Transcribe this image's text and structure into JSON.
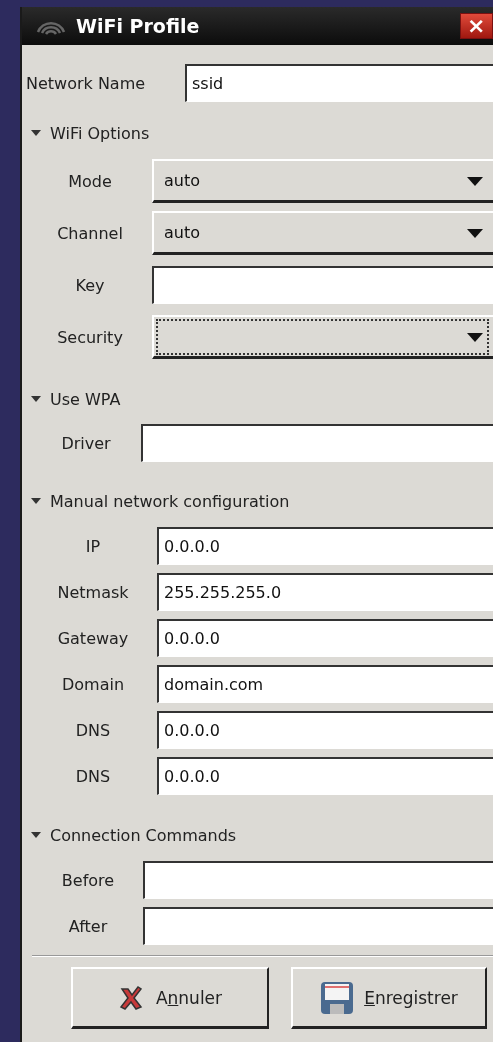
{
  "window": {
    "title": "WiFi Profile",
    "close": "×"
  },
  "network_name": {
    "label": "Network Name",
    "value": "ssid"
  },
  "sections": [
    {
      "title": "WiFi Options",
      "expanded": true,
      "fields": [
        {
          "kind": "combo",
          "label": "Mode",
          "value": "auto",
          "focused": false
        },
        {
          "kind": "combo",
          "label": "Channel",
          "value": "auto",
          "focused": false
        },
        {
          "kind": "entry",
          "label": "Key"
        },
        {
          "kind": "combo",
          "label": "Security",
          "focused": true
        }
      ]
    },
    {
      "title": "Use WPA",
      "expanded": true,
      "fields": [
        {
          "kind": "entry",
          "label": "Driver"
        }
      ]
    },
    {
      "title": "Manual network configuration",
      "expanded": true,
      "fields": [
        {
          "kind": "entry",
          "label": "IP",
          "value": "0.0.0.0"
        },
        {
          "kind": "entry",
          "label": "Netmask",
          "value": "255.255.255.0"
        },
        {
          "kind": "entry",
          "label": "Gateway",
          "value": "0.0.0.0"
        },
        {
          "kind": "entry",
          "label": "Domain",
          "value": "domain.com"
        },
        {
          "kind": "entry",
          "label": "DNS",
          "value": "0.0.0.0"
        },
        {
          "kind": "entry",
          "label": "DNS",
          "value": "0.0.0.0"
        }
      ]
    },
    {
      "title": "Connection Commands",
      "expanded": true,
      "fields": [
        {
          "kind": "entry",
          "label": "Before"
        },
        {
          "kind": "entry",
          "label": "After"
        }
      ]
    }
  ],
  "buttons": [
    {
      "kind": "cancel",
      "label_before": "A",
      "mnemonic": "n",
      "label_after": "nuler"
    },
    {
      "kind": "save",
      "mnemonic": "E",
      "label_after": "nregistrer"
    }
  ]
}
